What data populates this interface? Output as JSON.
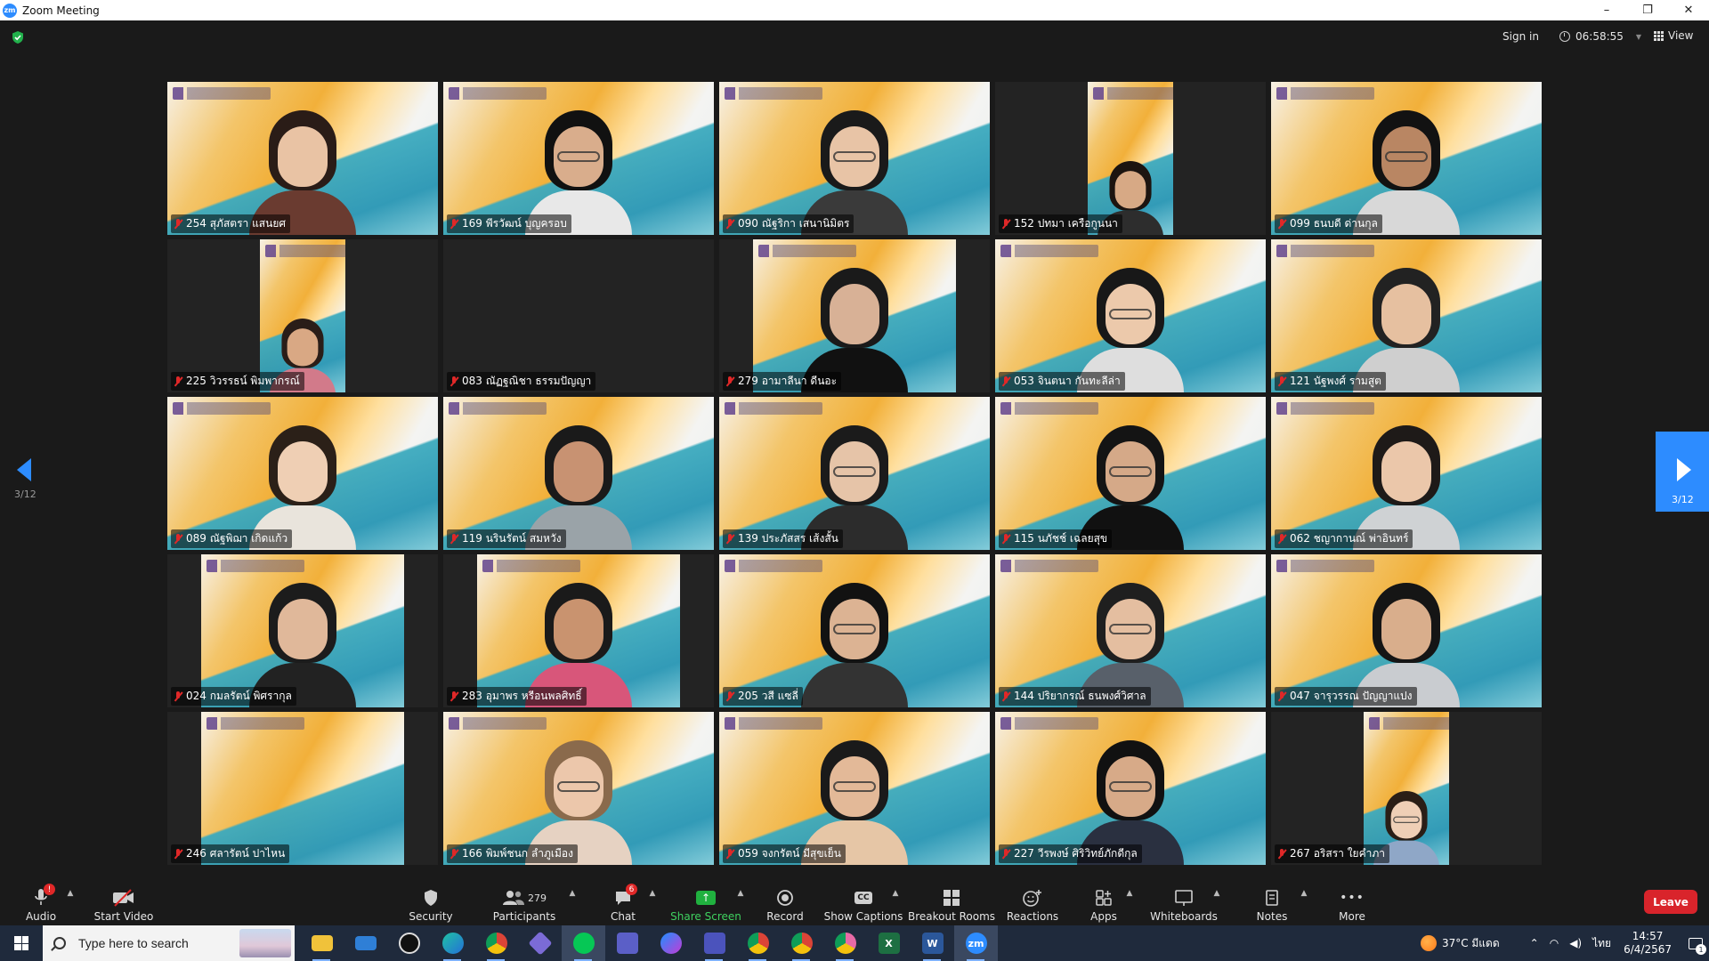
{
  "window": {
    "title": "Zoom Meeting",
    "logo": "zm",
    "minimize": "–",
    "restore": "❐",
    "close": "✕"
  },
  "topbar": {
    "sign_in": "Sign in",
    "timer": "06:58:55",
    "view": "View"
  },
  "pagination": {
    "left_label": "3/12",
    "right_label": "3/12"
  },
  "participants": [
    {
      "name": "254 สุภัสตรา แสนยศ",
      "muted": true
    },
    {
      "name": "169 พีรวัฒน์ บุญครอบ",
      "muted": true
    },
    {
      "name": "090 ณัฐริกา เสนานิมิตร",
      "muted": true
    },
    {
      "name": "152 ปทมา เครือกูนนา",
      "muted": true
    },
    {
      "name": "099 ธนบดี ด่านกุล",
      "muted": true
    },
    {
      "name": "225 วิวรรธน์ พิมพากรณ์",
      "muted": true
    },
    {
      "name": "083 ณัฏฐณิชา ธรรมปัญญา",
      "muted": true
    },
    {
      "name": "279 อามาลีนา ดีนอะ",
      "muted": true
    },
    {
      "name": "053 จินตนา กันทะลีล่า",
      "muted": true
    },
    {
      "name": "121 นัฐพงศ์ รามสูต",
      "muted": true
    },
    {
      "name": "089 ณัฐพิฌา เกิดแก้ว",
      "muted": true
    },
    {
      "name": "119 นรินรัตน์ สมหวัง",
      "muted": true
    },
    {
      "name": "139 ประภัสสร เส้งสั้น",
      "muted": true
    },
    {
      "name": "115 นภัชช์ เฉลยสุข",
      "muted": true
    },
    {
      "name": "062 ชญากานณ์ พ่าอินทร์",
      "muted": true
    },
    {
      "name": "024 กมลรัตน์ พิศรากุล",
      "muted": true
    },
    {
      "name": "283 อุมาพร หรีอนพลศิทธิ์",
      "muted": true
    },
    {
      "name": "205 วสี แซลี่",
      "muted": true
    },
    {
      "name": "144 ปริยากรณ์ ธนพงศ์วิศาล",
      "muted": true
    },
    {
      "name": "047 จารุวรรณ ปัญญาแปง",
      "muted": true
    },
    {
      "name": "246 ศลารัตน์ ปาไหน",
      "muted": true
    },
    {
      "name": "166 พิมพ์ชนก ลำภูเมือง",
      "muted": true
    },
    {
      "name": "059 จงกรัตน์ มีสุขเย็น",
      "muted": true
    },
    {
      "name": "227 วีรพงษ์ ศิริวิทย์ภักดีกุล",
      "muted": true
    },
    {
      "name": "267 อริสรา ใยคำภา",
      "muted": true
    }
  ],
  "toolbar": {
    "audio": "Audio",
    "audio_badge": "!",
    "video": "Start Video",
    "security": "Security",
    "participants": "Participants",
    "participants_count": "279",
    "chat": "Chat",
    "chat_badge": "6",
    "share": "Share Screen",
    "record": "Record",
    "captions": "Show Captions",
    "captions_icon": "CC",
    "breakout": "Breakout Rooms",
    "reactions": "Reactions",
    "apps": "Apps",
    "whiteboards": "Whiteboards",
    "notes": "Notes",
    "more": "More",
    "more_icon": "•••",
    "leave": "Leave"
  },
  "taskbar": {
    "search_placeholder": "Type here to search",
    "weather": "37°C มีแดด",
    "lang": "ไทย",
    "time": "14:57",
    "date": "6/4/2567",
    "notif_count": "1",
    "zoom_app_label": "zm",
    "excel_label": "X",
    "word_label": "W"
  },
  "colors": {
    "accent": "#2D8CFF",
    "leave": "#D9242B",
    "share": "#20B13F",
    "muted_mic": "#E02828"
  }
}
